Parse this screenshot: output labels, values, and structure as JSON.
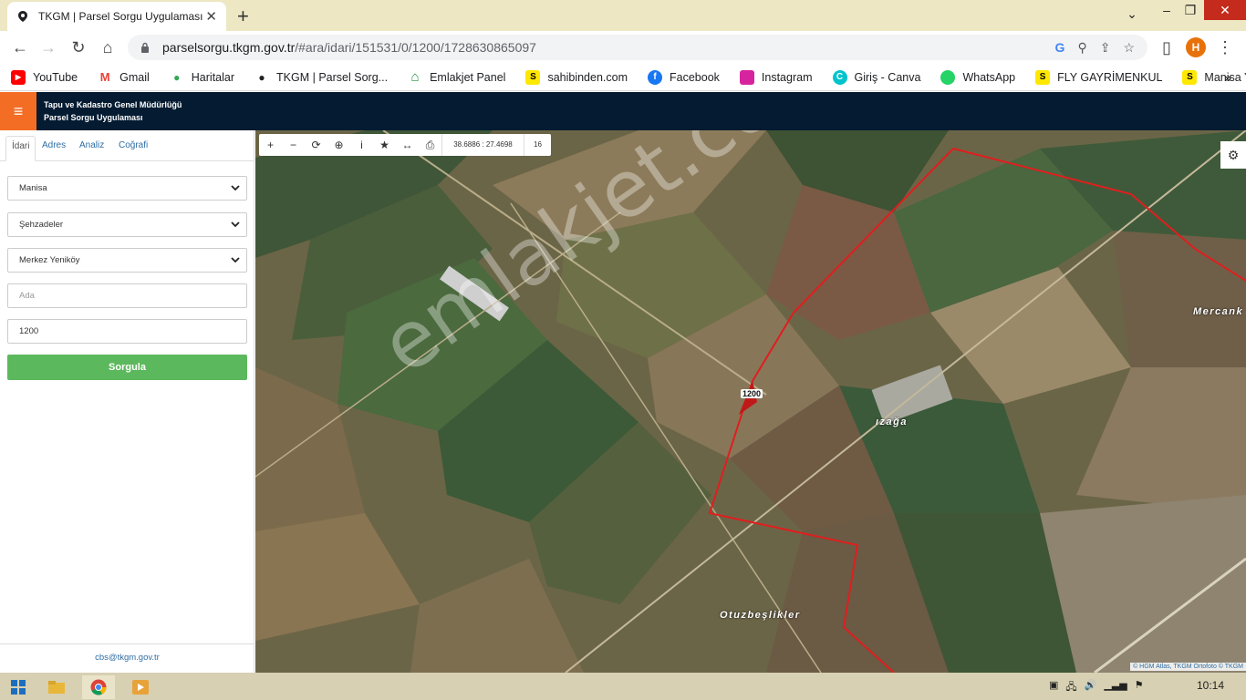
{
  "browser": {
    "tab_title": "TKGM | Parsel Sorgu Uygulaması",
    "url_host": "parselsorgu.tkgm.gov.tr",
    "url_path": "/#ara/idari/151531/0/1200/1728630865097",
    "profile_initial": "H"
  },
  "bookmarks": [
    {
      "label": "YouTube",
      "icon": "youtube-icon",
      "color": "#ff0000"
    },
    {
      "label": "Gmail",
      "icon": "gmail-icon",
      "color": "#ea4335"
    },
    {
      "label": "Haritalar",
      "icon": "maps-icon",
      "color": "#34a853"
    },
    {
      "label": "TKGM | Parsel Sorg...",
      "icon": "pin-icon",
      "color": "#202124"
    },
    {
      "label": "Emlakjet Panel",
      "icon": "house-icon",
      "color": "#1e8e3e"
    },
    {
      "label": "sahibinden.com",
      "icon": "sahibinden-icon",
      "color": "#ffe800"
    },
    {
      "label": "Facebook",
      "icon": "facebook-icon",
      "color": "#1877f2"
    },
    {
      "label": "Instagram",
      "icon": "instagram-icon",
      "color": "#d6249f"
    },
    {
      "label": "Giriş - Canva",
      "icon": "canva-icon",
      "color": "#00c4cc"
    },
    {
      "label": "WhatsApp",
      "icon": "whatsapp-icon",
      "color": "#25d366"
    },
    {
      "label": "FLY GAYRİMENKUL",
      "icon": "sahibinden-icon",
      "color": "#ffe800"
    },
    {
      "label": "Manisa Yunusemre...",
      "icon": "sahibinden-icon",
      "color": "#ffe800"
    }
  ],
  "app": {
    "title_line1": "Tapu ve Kadastro Genel Müdürlüğü",
    "title_line2": "Parsel Sorgu Uygulaması"
  },
  "panel": {
    "tabs": [
      "İdari",
      "Adres",
      "Analiz",
      "Coğrafi"
    ],
    "province": "Manisa",
    "district": "Şehzadeler",
    "neighborhood": "Merkez Yeniköy",
    "ada_placeholder": "Ada",
    "parsel_value": "1200",
    "submit_label": "Sorgula",
    "footer_email": "cbs@tkgm.gov.tr"
  },
  "map": {
    "coordinates": "38.6886 : 27.4698",
    "zoom": "16",
    "parcel_label": "1200",
    "place_labels": [
      "Mercank",
      "ızağa",
      "Otuzbeşlikler"
    ],
    "watermark": "emlakjet.com",
    "attribution": "© HGM Atlas, TKGM Ortofoto © TKGM"
  },
  "taskbar": {
    "time": "10:14"
  }
}
